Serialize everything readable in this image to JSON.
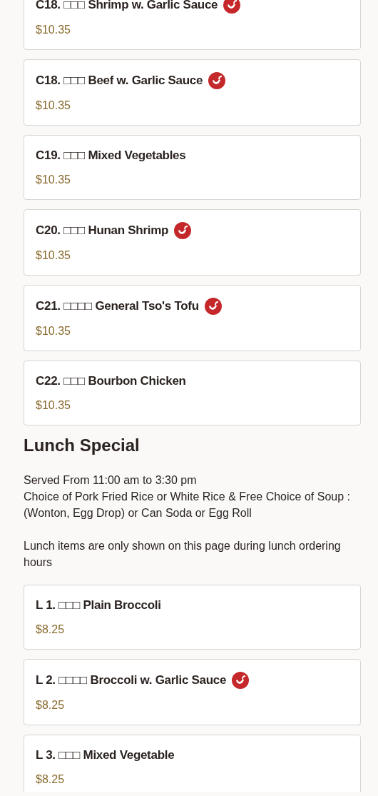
{
  "items_top": [
    {
      "name": "C18. □□□ Shrimp w. Garlic Sauce",
      "spicy": true,
      "price": "$10.35"
    },
    {
      "name": "C18. □□□ Beef w. Garlic Sauce",
      "spicy": true,
      "price": "$10.35"
    },
    {
      "name": "C19. □□□ Mixed Vegetables",
      "spicy": false,
      "price": "$10.35"
    },
    {
      "name": "C20. □□□ Hunan Shrimp",
      "spicy": true,
      "price": "$10.35"
    },
    {
      "name": "C21. □□□□ General Tso's Tofu",
      "spicy": true,
      "price": "$10.35"
    },
    {
      "name": "C22. □□□ Bourbon Chicken",
      "spicy": false,
      "price": "$10.35"
    }
  ],
  "section": {
    "title": "Lunch Special",
    "description": [
      "Served From 11:00 am to 3:30 pm",
      "Choice of Pork Fried Rice or White Rice & Free Choice of Soup : (Wonton, Egg Drop) or Can Soda or Egg Roll"
    ],
    "note": "Lunch items are only shown on this page during lunch ordering hours",
    "items": [
      {
        "name": "L 1. □□□ Plain Broccoli",
        "spicy": false,
        "price": "$8.25"
      },
      {
        "name": "L 2. □□□□ Broccoli w. Garlic Sauce",
        "spicy": true,
        "price": "$8.25"
      },
      {
        "name": "L 3. □□□ Mixed Vegetable",
        "spicy": false,
        "price": "$8.25"
      }
    ]
  }
}
